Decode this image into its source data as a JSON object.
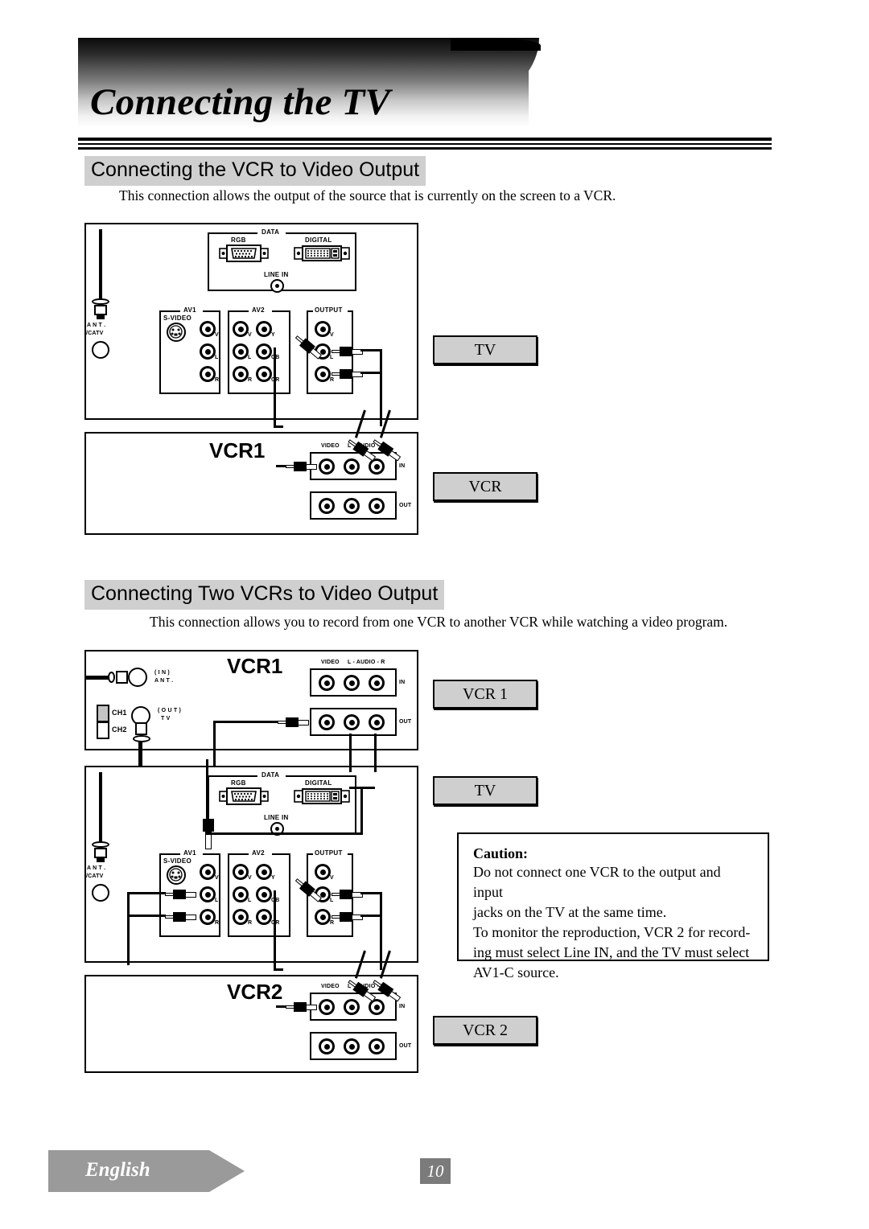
{
  "page": {
    "title": "Connecting the TV",
    "language_tag": "English",
    "page_number": "10"
  },
  "sections": [
    {
      "heading": "Connecting the VCR to Video Output",
      "body": "This connection allows the output of the source that is currently on the screen to a VCR.",
      "captions": [
        "TV",
        "VCR"
      ]
    },
    {
      "heading": "Connecting Two VCRs to Video Output",
      "body": "This connection allows you to record from one VCR to another VCR while watching a video program.",
      "captions": [
        "VCR 1",
        "TV",
        "VCR 2"
      ]
    }
  ],
  "caution": {
    "title": "Caution:",
    "lines": [
      "Do not connect one VCR to the output and input",
      "jacks on the TV at the same time.",
      "To monitor the reproduction, VCR 2 for record-",
      "ing must select Line IN, and the TV must select",
      "AV1-C source."
    ]
  },
  "tv_panel": {
    "antenna_label_line1": "A N T .",
    "antenna_label_line2": "/CATV",
    "data_group": "DATA",
    "rgb_label": "RGB",
    "digital_label": "DIGITAL",
    "line_in_label": "LINE IN",
    "av1_group": "AV1",
    "svideo_label": "S-VIDEO",
    "av1_jacks": [
      "V",
      "L",
      "R"
    ],
    "av2_group": "AV2",
    "av2_jacks_left": [
      "V",
      "L",
      "R"
    ],
    "av2_jacks_right": [
      "Y",
      "CB",
      "CR"
    ],
    "output_group": "OUTPUT",
    "output_jacks": [
      "V",
      "L",
      "R"
    ]
  },
  "vcr_panel": {
    "name_1": "VCR1",
    "name_2": "VCR2",
    "video_label": "VIDEO",
    "audio_label": "L - AUDIO - R",
    "in_label": "IN",
    "out_label": "OUT",
    "ant_in_line1": "( I N )",
    "ant_in_line2": "A N T .",
    "tv_out_line1": "( O U T )",
    "tv_out_line2": "T V",
    "ch1_label": "CH1",
    "ch2_label": "CH2"
  },
  "colors": {
    "heading_background": "#cfcfcf",
    "caption_background": "#cfcfcf",
    "footer_tag": "#9a9a9a",
    "page_number_background": "#7b7b7b",
    "ink": "#000000"
  }
}
